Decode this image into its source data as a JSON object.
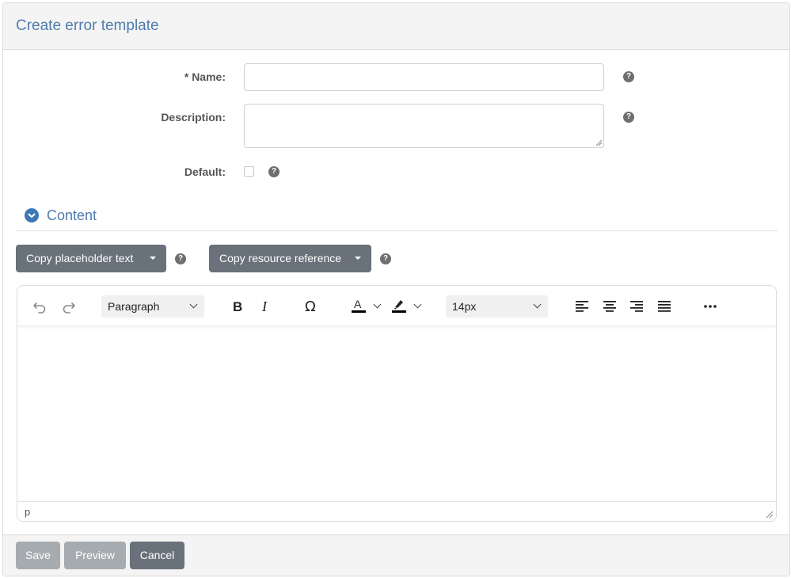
{
  "header": {
    "title": "Create error template"
  },
  "form": {
    "name_label": "* Name:",
    "name_value": "",
    "description_label": "Description:",
    "description_value": "",
    "default_label": "Default:",
    "help_glyph": "?"
  },
  "section": {
    "title": "Content",
    "expanded": true
  },
  "dropdowns": {
    "placeholder_label": "Copy placeholder text",
    "resource_label": "Copy resource reference"
  },
  "editor": {
    "block_format": "Paragraph",
    "font_size": "14px",
    "status_path": "p",
    "toolbar_icons": [
      "undo-icon",
      "redo-icon",
      "bold-icon",
      "italic-icon",
      "special-character-icon",
      "text-color-icon",
      "highlight-color-icon",
      "align-left-icon",
      "align-center-icon",
      "align-right-icon",
      "justify-icon",
      "more-icon"
    ]
  },
  "footer": {
    "save_label": "Save",
    "preview_label": "Preview",
    "cancel_label": "Cancel"
  },
  "colors": {
    "title": "#4f7cac",
    "accent": "#3b78b5",
    "button_dark": "#69717a",
    "button_disabled": "#a6abaf"
  }
}
